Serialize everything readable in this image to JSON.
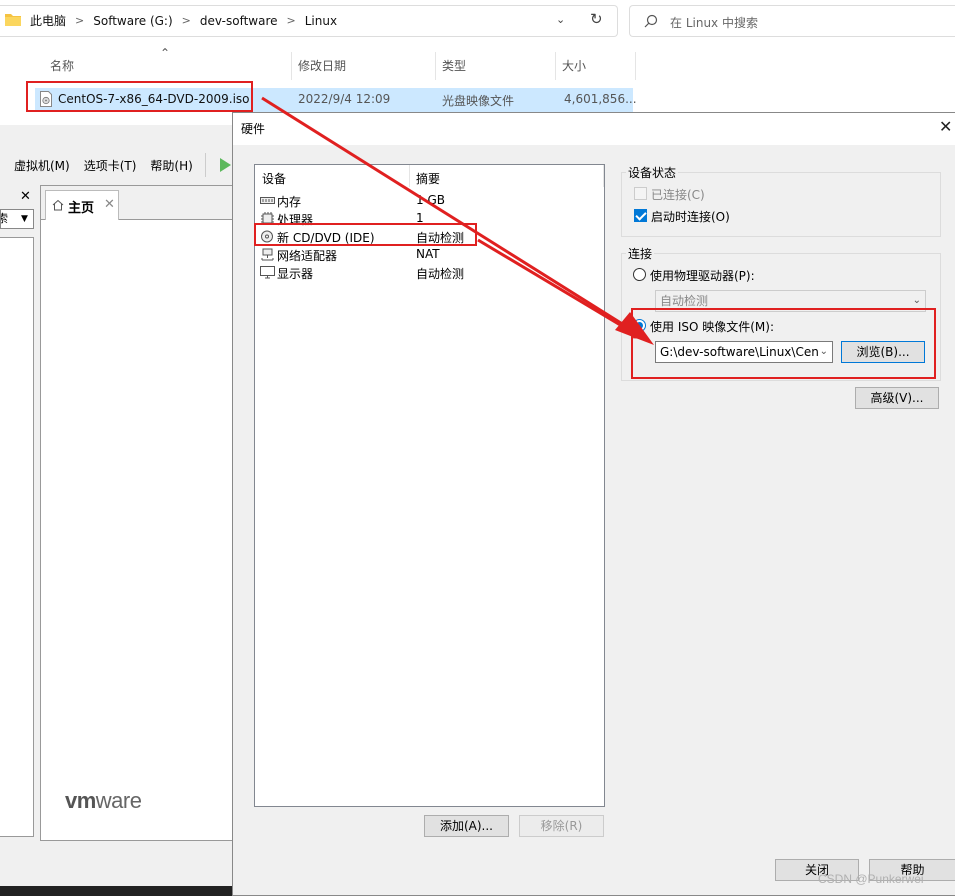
{
  "explorer": {
    "breadcrumbs": [
      "此电脑",
      "Software (G:)",
      "dev-software",
      "Linux"
    ],
    "search_placeholder": "在 Linux 中搜索",
    "columns": [
      "名称",
      "修改日期",
      "类型",
      "大小"
    ],
    "file": {
      "name": "CentOS-7-x86_64-DVD-2009.iso",
      "modified": "2022/9/4 12:09",
      "type": "光盘映像文件",
      "size": "4,601,856..."
    }
  },
  "vmware": {
    "menu": [
      "虚拟机(M)",
      "选项卡(T)",
      "帮助(H)"
    ],
    "close_glyph": "✕",
    "lib_search_text": "索",
    "home_tab": "主页",
    "logo_prefix": "vm",
    "logo_suffix": "ware"
  },
  "dialog": {
    "title": "硬件",
    "list_headers": {
      "device": "设备",
      "summary": "摘要"
    },
    "devices": [
      {
        "name": "内存",
        "summary": "1 GB",
        "icon": "memory-icon"
      },
      {
        "name": "处理器",
        "summary": "1",
        "icon": "cpu-icon"
      },
      {
        "name": "新 CD/DVD (IDE)",
        "summary": "自动检测",
        "icon": "cd-icon"
      },
      {
        "name": "网络适配器",
        "summary": "NAT",
        "icon": "network-icon"
      },
      {
        "name": "显示器",
        "summary": "自动检测",
        "icon": "monitor-icon"
      }
    ],
    "add_button": "添加(A)...",
    "remove_button": "移除(R)",
    "device_status": {
      "label": "设备状态",
      "connected": "已连接(C)",
      "connect_at_power_on": "启动时连接(O)",
      "connected_checked": false,
      "connect_at_power_on_checked": true
    },
    "connection": {
      "label": "连接",
      "physical_drive": "使用物理驱动器(P):",
      "physical_value": "自动检测",
      "iso_image": "使用 ISO 映像文件(M):",
      "iso_path": "G:\\dev-software\\Linux\\Cent",
      "browse_button": "浏览(B)...",
      "selected": "iso"
    },
    "advanced_button": "高级(V)...",
    "close_button": "关闭",
    "help_button": "帮助"
  },
  "colors": {
    "accent": "#0078d7",
    "annotation": "#e02020",
    "selection": "#cce8ff"
  },
  "watermark": "CSDN @Punkerwei"
}
